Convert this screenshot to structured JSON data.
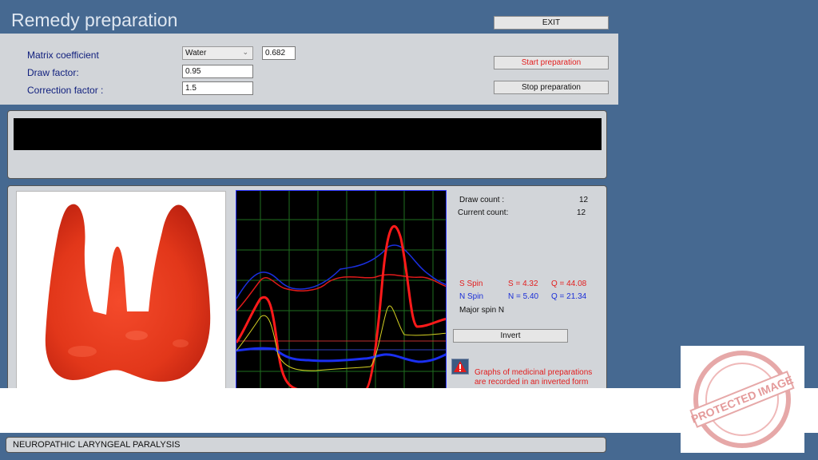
{
  "window": {
    "title": "Remedy preparation"
  },
  "buttons": {
    "exit": "EXIT",
    "start": "Start preparation",
    "stop": "Stop preparation",
    "invert": "Invert"
  },
  "form": {
    "matrix_label": "Matrix coefficient",
    "matrix_select": "Water",
    "matrix_value": "0.682",
    "draw_label": "Draw factor:",
    "draw_value": "0.95",
    "correction_label": "Correction factor :",
    "correction_value": "1.5"
  },
  "stats": {
    "draw_count_label": "Draw count :",
    "draw_count_value": "12",
    "current_count_label": "Current count:",
    "current_count_value": "12",
    "s_spin_label": "S Spin",
    "s_value": "S = 4.32",
    "s_q": "Q = 44.08",
    "n_spin_label": "N Spin",
    "n_value": "N = 5.40",
    "n_q": "Q = 21.34",
    "major_spin": "Major spin N"
  },
  "warning": {
    "line1": "Graphs of medicinal preparations",
    "line2": "are recorded in an inverted form"
  },
  "status": {
    "diagnosis": "NEUROPATHIC LARYNGEAL PARALYSIS"
  },
  "watermark": {
    "text": "PROTECTED IMAGE"
  },
  "colors": {
    "background": "#466991",
    "panel": "#d2d5d9",
    "accent_red": "#e21e1e",
    "accent_blue": "#1b2fd8"
  },
  "icons": {
    "select_arrow": "chevron-down-icon",
    "warning": "warning-triangle-icon"
  }
}
